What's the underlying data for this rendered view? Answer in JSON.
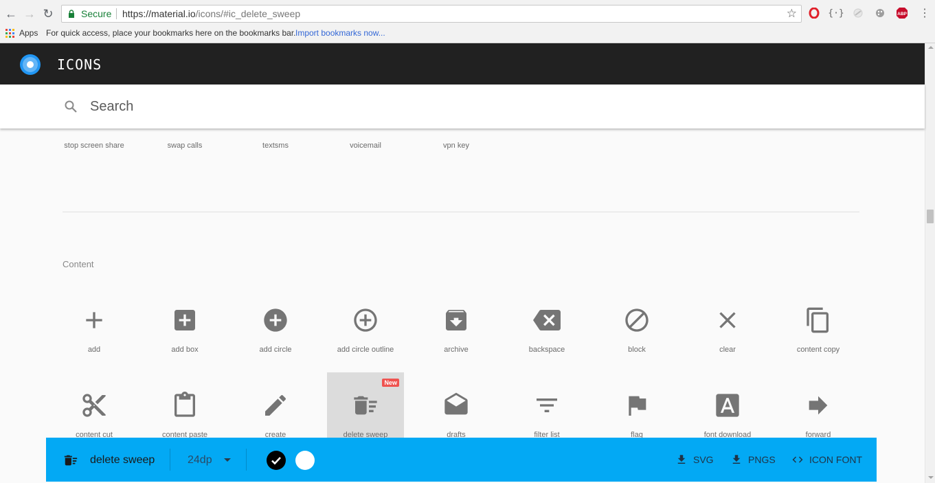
{
  "browser": {
    "secure_label": "Secure",
    "url_host": "https://material.io",
    "url_path": "/icons/#ic_delete_sweep",
    "bookmarks": {
      "apps_label": "Apps",
      "hint": "For quick access, place your bookmarks here on the bookmarks bar.",
      "import_link": "Import bookmarks now..."
    },
    "extensions": [
      "opera-icon",
      "json-viewer-icon",
      "lightbeam-icon",
      "palette-icon",
      "adblock-plus-icon"
    ],
    "extension_abp_text": "ABP"
  },
  "app": {
    "title": "ICONS",
    "search_placeholder": "Search"
  },
  "previous_section": {
    "labels": [
      "stop screen share",
      "swap calls",
      "textsms",
      "voicemail",
      "vpn key"
    ]
  },
  "section": {
    "title": "Content",
    "rows": [
      [
        {
          "name": "add",
          "icon": "add-icon"
        },
        {
          "name": "add box",
          "icon": "add-box-icon"
        },
        {
          "name": "add circle",
          "icon": "add-circle-icon"
        },
        {
          "name": "add circle outline",
          "icon": "add-circle-outline-icon"
        },
        {
          "name": "archive",
          "icon": "archive-icon"
        },
        {
          "name": "backspace",
          "icon": "backspace-icon"
        },
        {
          "name": "block",
          "icon": "block-icon"
        },
        {
          "name": "clear",
          "icon": "clear-icon"
        },
        {
          "name": "content copy",
          "icon": "content-copy-icon"
        }
      ],
      [
        {
          "name": "content cut",
          "icon": "content-cut-icon"
        },
        {
          "name": "content paste",
          "icon": "content-paste-icon"
        },
        {
          "name": "create",
          "icon": "create-icon"
        },
        {
          "name": "delete sweep",
          "icon": "delete-sweep-icon",
          "selected": true,
          "badge": "New"
        },
        {
          "name": "drafts",
          "icon": "drafts-icon"
        },
        {
          "name": "filter list",
          "icon": "filter-list-icon"
        },
        {
          "name": "flag",
          "icon": "flag-icon"
        },
        {
          "name": "font download",
          "icon": "font-download-icon"
        },
        {
          "name": "forward",
          "icon": "forward-icon"
        }
      ]
    ]
  },
  "bottom_bar": {
    "selected_icon": "delete-sweep-icon",
    "selected_name": "delete sweep",
    "size": "24dp",
    "color_dark": "#000000",
    "color_light": "#ffffff",
    "downloads": {
      "svg": "SVG",
      "pngs": "PNGS",
      "icon_font": "ICON FONT"
    }
  },
  "colors": {
    "app_bar": "#212121",
    "accent": "#03a9f4",
    "icon": "#757575",
    "secure": "#188038",
    "badge": "#ef5350"
  }
}
